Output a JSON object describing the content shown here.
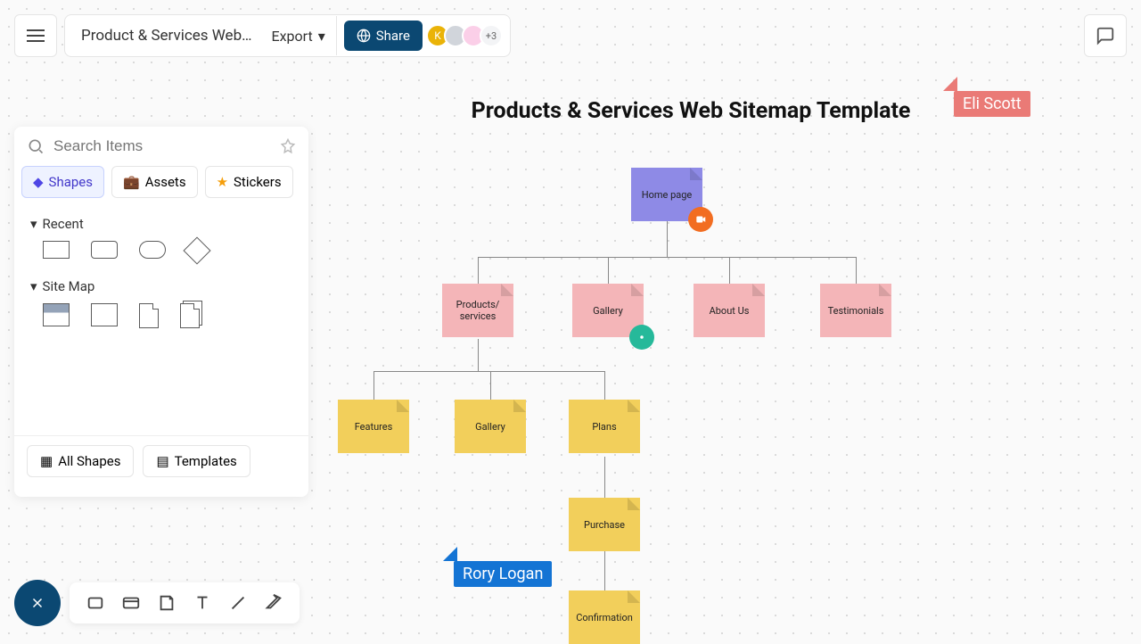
{
  "header": {
    "doc_title": "Product & Services Web…",
    "export_label": "Export",
    "share_label": "Share",
    "avatar_more": "+3"
  },
  "panel": {
    "search_placeholder": "Search Items",
    "tabs": {
      "shapes": "Shapes",
      "assets": "Assets",
      "stickers": "Stickers"
    },
    "section_recent": "Recent",
    "section_sitemap": "Site Map",
    "all_shapes": "All Shapes",
    "templates": "Templates"
  },
  "canvas": {
    "title": "Products & Services Web Sitemap Template"
  },
  "cursors": {
    "eli": "Eli Scott",
    "rory": "Rory Logan"
  },
  "nodes": {
    "home": "Home page",
    "products": "Products/\nservices",
    "gallery1": "Gallery",
    "about": "About Us",
    "testimonials": "Testimonials",
    "features": "Features",
    "gallery2": "Gallery",
    "plans": "Plans",
    "purchase": "Purchase",
    "confirmation": "Confirmation"
  }
}
